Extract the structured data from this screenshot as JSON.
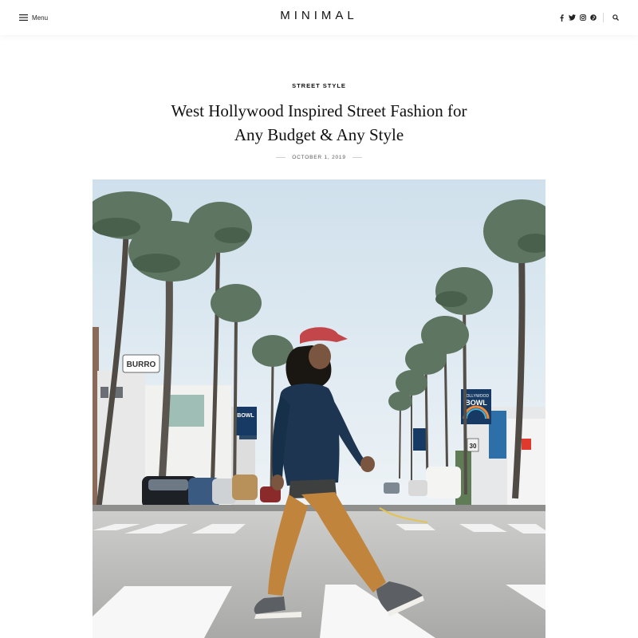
{
  "header": {
    "menu_label": "Menu",
    "logo": "MINIMAL",
    "icons": [
      "hamburger-icon",
      "facebook-icon",
      "twitter-icon",
      "instagram-icon",
      "pinterest-icon",
      "search-icon"
    ]
  },
  "article": {
    "category": "STREET STYLE",
    "title_line1": "West Hollywood Inspired Street Fashion for",
    "title_line2": "Any Budget & Any Style",
    "date": "OCTOBER 1, 2019"
  },
  "photo": {
    "signs": {
      "burro": "BURRO",
      "hollywood_bowl_top": "HOLLYWOOD",
      "hollywood_bowl": "BOWL",
      "bowl_left": "BOWL",
      "speed": "30"
    }
  },
  "colors": {
    "text": "#111111",
    "sky": "#dbe8f0",
    "road": "#b9b9b7",
    "cap": "#c3474a",
    "jacket": "#1d3550",
    "pants": "#c0843c"
  }
}
